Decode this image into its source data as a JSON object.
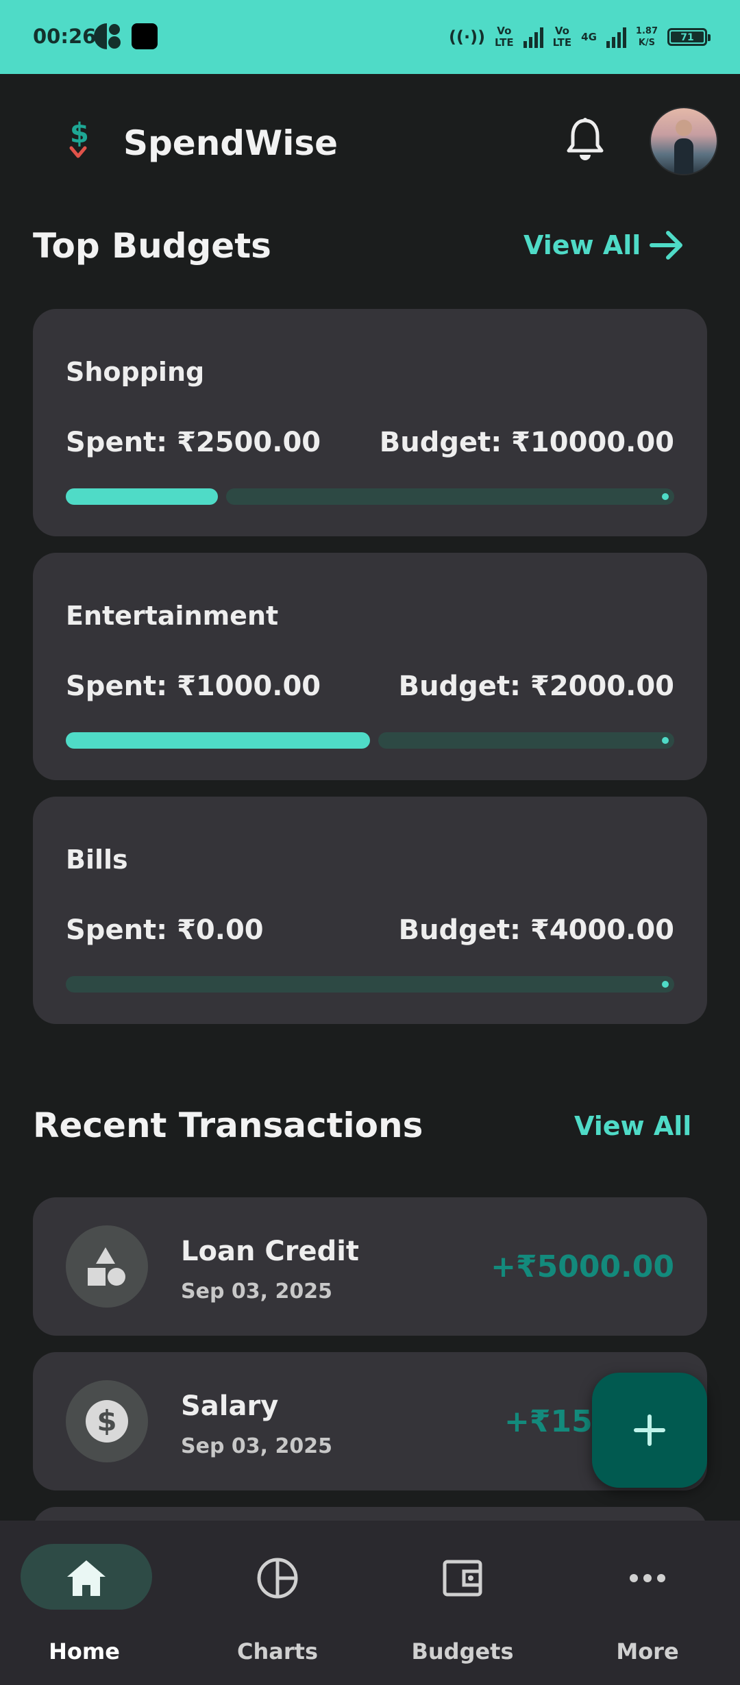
{
  "status_bar": {
    "time": "00:26",
    "net1": "Vo\nLTE",
    "net2": "Vo\nLTE",
    "net3": "4G",
    "speed": "1.87\nK/S",
    "battery": "71"
  },
  "app_bar": {
    "title": "SpendWise"
  },
  "top_budgets": {
    "title": "Top Budgets",
    "view_all": "View All",
    "items": [
      {
        "name": "Shopping",
        "spent": "Spent: ₹2500.00",
        "budget": "Budget: ₹10000.00",
        "progress": 0.25
      },
      {
        "name": "Entertainment",
        "spent": "Spent: ₹1000.00",
        "budget": "Budget: ₹2000.00",
        "progress": 0.5
      },
      {
        "name": "Bills",
        "spent": "Spent: ₹0.00",
        "budget": "Budget: ₹4000.00",
        "progress": 0
      }
    ]
  },
  "recent_transactions": {
    "title": "Recent Transactions",
    "view_all": "View All",
    "items": [
      {
        "name": "Loan Credit",
        "date": "Sep 03, 2025",
        "amount": "+₹5000.00",
        "icon": "shapes-icon"
      },
      {
        "name": "Salary",
        "date": "Sep 03, 2025",
        "amount": "+₹1500",
        "icon": "dollar-icon"
      }
    ]
  },
  "bottom_nav": {
    "items": [
      {
        "label": "Home",
        "icon": "home-icon",
        "active": true
      },
      {
        "label": "Charts",
        "icon": "pie-chart-icon",
        "active": false
      },
      {
        "label": "Budgets",
        "icon": "wallet-icon",
        "active": false
      },
      {
        "label": "More",
        "icon": "more-icon",
        "active": false
      }
    ]
  },
  "colors": {
    "accent": "#4fdbc7",
    "background": "#1b1d1d",
    "card": "#353439",
    "income": "#138a7c",
    "fab": "#015a50"
  }
}
